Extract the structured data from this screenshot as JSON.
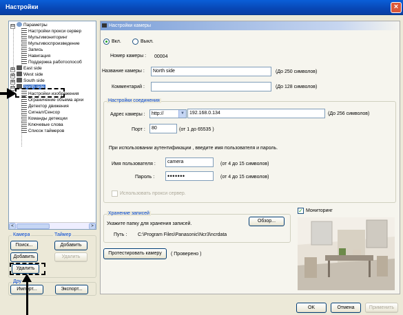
{
  "window": {
    "title": "Настройки",
    "close_glyph": "×"
  },
  "tree": {
    "items": [
      {
        "label": "Параметры",
        "icon": "root-icon",
        "expander": "⊟"
      },
      {
        "label": "Настройки прокси сервер",
        "icon": "list-icon"
      },
      {
        "label": "Мультимониторинг",
        "icon": "list-icon"
      },
      {
        "label": "Мультивоспроизведение",
        "icon": "list-icon"
      },
      {
        "label": "Запись",
        "icon": "list-icon"
      },
      {
        "label": "Навигация",
        "icon": "list-icon"
      },
      {
        "label": "Поддержка работоспособ",
        "icon": "list-icon"
      },
      {
        "label": "East side",
        "icon": "camera-icon",
        "expander": "⊞"
      },
      {
        "label": "West side",
        "icon": "camera-icon",
        "expander": "⊞"
      },
      {
        "label": "South side",
        "icon": "camera-icon",
        "expander": "⊞"
      },
      {
        "label": "North side",
        "icon": "camera-icon",
        "expander": "⊟",
        "selected": true
      },
      {
        "label": "Настройки изображения",
        "icon": "list-icon"
      },
      {
        "label": "Ограничение объема архи",
        "icon": "list-icon"
      },
      {
        "label": "Детектор движения",
        "icon": "list-icon"
      },
      {
        "label": "Сигнал/Сенсор",
        "icon": "list-icon"
      },
      {
        "label": "Команды детекции",
        "icon": "list-icon"
      },
      {
        "label": "Ключевые слова",
        "icon": "list-icon"
      },
      {
        "label": "Список таймеров",
        "icon": "list-icon"
      }
    ],
    "scroll_left": "<",
    "scroll_right": ">"
  },
  "left_panel": {
    "camera_group": "Камера",
    "timer_group": "Таймер",
    "search_button": "Поиск...",
    "add_camera_button": "Добавить",
    "add_timer_button": "Добавить",
    "delete_camera_button": "Удалить",
    "delete_timer_button": "Удалить",
    "other_group": "Дру",
    "import_button": "Импорт...",
    "export_button": "Экспорт..."
  },
  "panel": {
    "header": "Настройки камеры",
    "on_label": "Вкл.",
    "off_label": "Выкл.",
    "camera_number_label": "Номер камеры :",
    "camera_number_value": "00004",
    "camera_name_label": "Название камеры :",
    "camera_name_value": "North side",
    "camera_name_hint": "(До 250 символов)",
    "comment_label": "Комментарий :",
    "comment_value": "",
    "comment_hint": "(До 128 символов)",
    "connection_group": "Настройки соединения",
    "address_label": "Адрес камеры :",
    "protocol_value": "http://",
    "address_value": "192.168.0.134",
    "address_hint": "(До 256 символов)",
    "port_label": "Порт :",
    "port_value": "80",
    "port_hint": "(от 1 до 65535 )",
    "auth_note": "При использовании аутентификации , введите имя пользователя и пароль.",
    "user_label": "Имя пользователя :",
    "user_value": "camera",
    "user_hint": "(от 4 до 15 символов)",
    "password_label": "Пароль :",
    "password_value": "•••••••",
    "password_hint": "(от 4 до 15 символов)",
    "proxy_label": "Использовать прокси сервер.",
    "storage_group": "Хранение записей",
    "storage_note": "Укажите папку для хранения записей.",
    "browse_button": "Обзор...",
    "path_label": "Путь :",
    "path_value": "C:\\Program Files\\Panasonic\\Ncr3\\ncrdata",
    "test_button": "Протестировать камеру",
    "test_status": "( Проверено )",
    "monitoring_label": "Мониторинг",
    "checkmark": "✓"
  },
  "footer": {
    "ok_button": "OK",
    "cancel_button": "Отмена",
    "apply_button": "Применить"
  }
}
